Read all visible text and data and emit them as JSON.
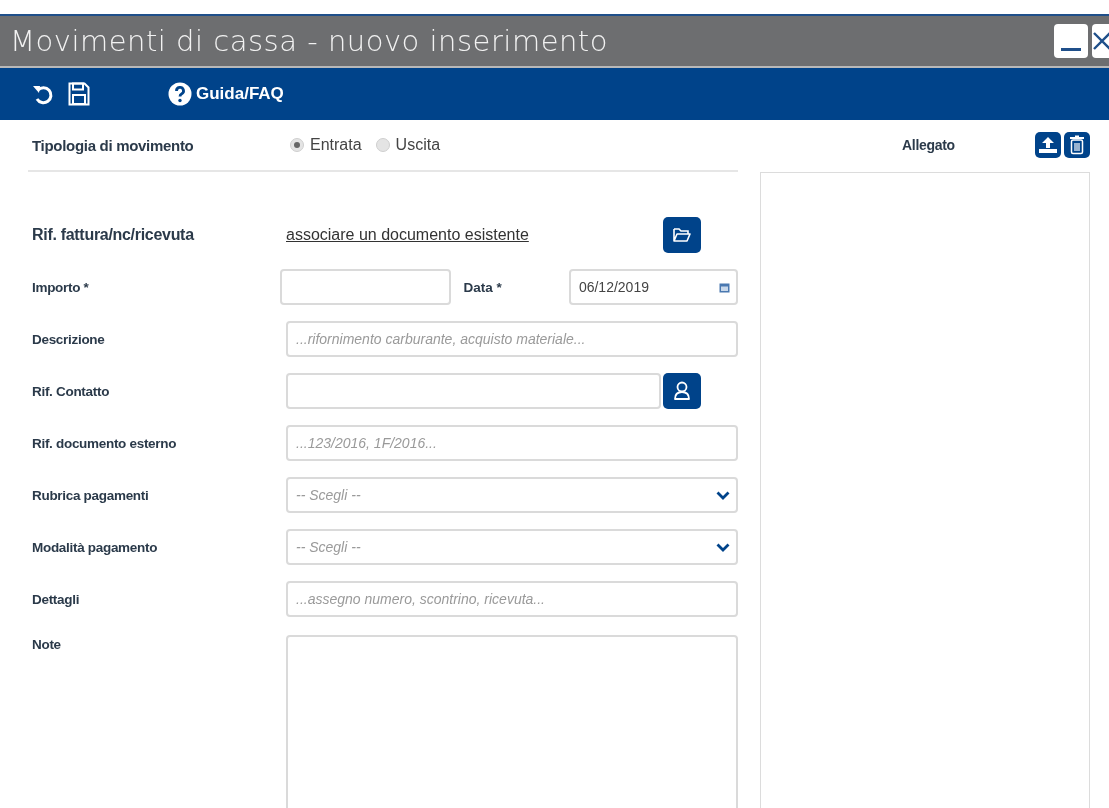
{
  "window": {
    "title": "Movimenti di cassa - nuovo inserimento"
  },
  "toolbar": {
    "help_label": "Guida/FAQ"
  },
  "movement_type": {
    "label": "Tipologia di movimento",
    "options": [
      {
        "label": "Entrata",
        "selected": true
      },
      {
        "label": "Uscita",
        "selected": false
      }
    ]
  },
  "fields": [
    {
      "kind": "link",
      "label": "Rif. fattura/nc/ricevuta",
      "link": "associare un documento esistente"
    },
    {
      "kind": "amount",
      "label": "Importo *",
      "date_label": "Data *",
      "date": "06/12/2019"
    },
    {
      "kind": "text",
      "label": "Descrizione",
      "placeholder": "...rifornimento carburante, acquisto materiale..."
    },
    {
      "kind": "contact",
      "label": "Rif. Contatto"
    },
    {
      "kind": "text",
      "label": "Rif. documento esterno",
      "placeholder": "...123/2016, 1F/2016..."
    },
    {
      "kind": "select",
      "label": "Rubrica pagamenti",
      "placeholder": "-- Scegli --"
    },
    {
      "kind": "select",
      "label": "Modalità pagamento",
      "placeholder": "-- Scegli --"
    },
    {
      "kind": "text",
      "label": "Dettagli",
      "placeholder": "...assegno numero, scontrino, ricevuta..."
    },
    {
      "kind": "textarea",
      "label": "Note"
    }
  ],
  "attachment": {
    "label": "Allegato"
  }
}
